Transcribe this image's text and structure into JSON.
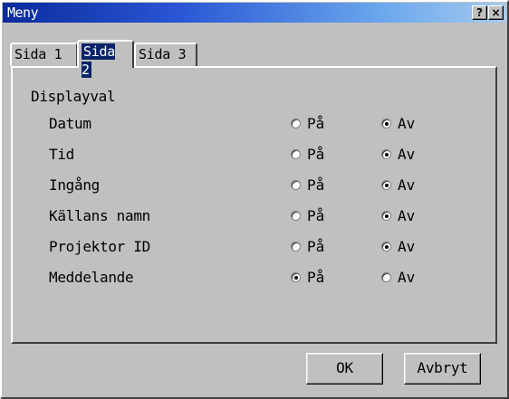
{
  "window": {
    "title": "Meny",
    "help_label": "?",
    "close_label": "×"
  },
  "tabs": [
    {
      "label": "Sida 1",
      "active": false
    },
    {
      "label": "Sida 2",
      "active": true
    },
    {
      "label": "Sida 3",
      "active": false
    }
  ],
  "group": {
    "label": "Displayval"
  },
  "options": {
    "on_label": "På",
    "off_label": "Av"
  },
  "rows": [
    {
      "label": "Datum",
      "selected": "Av"
    },
    {
      "label": "Tid",
      "selected": "Av"
    },
    {
      "label": "Ingång",
      "selected": "Av"
    },
    {
      "label": "Källans namn",
      "selected": "Av"
    },
    {
      "label": "Projektor ID",
      "selected": "Av"
    },
    {
      "label": "Meddelande",
      "selected": "På"
    }
  ],
  "buttons": {
    "ok_label": "OK",
    "cancel_label": "Avbryt"
  },
  "colors": {
    "title_gradient_start": "#0a2a9c",
    "title_gradient_end": "#a6caf0",
    "active_tab_highlight": "#0a246a",
    "face": "#c0c0c0"
  }
}
